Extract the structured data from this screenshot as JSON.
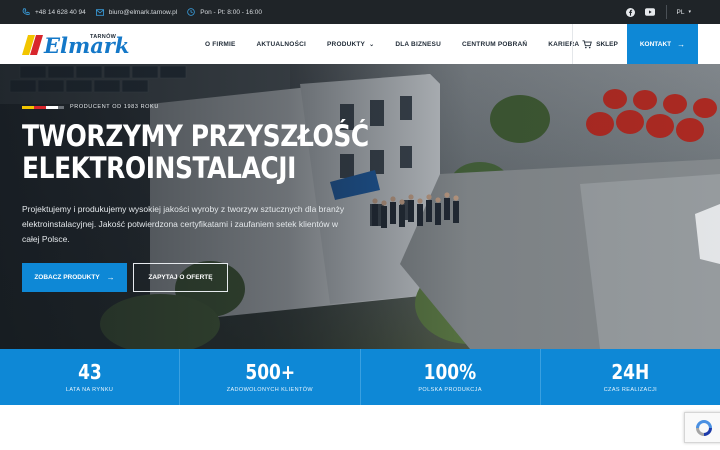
{
  "topbar": {
    "phone": "+48 14 628 40 94",
    "email": "biuro@elmark.tarnow.pl",
    "hours": "Pon - Pt: 8:00 - 16:00",
    "language": "PL"
  },
  "logo": {
    "brand": "Elmark",
    "city": "TARNÓW"
  },
  "nav": {
    "items": [
      {
        "label": "O FIRMIE"
      },
      {
        "label": "AKTUALNOŚCI"
      },
      {
        "label": "PRODUKTY"
      },
      {
        "label": "DLA BIZNESU"
      },
      {
        "label": "CENTRUM POBRAŃ"
      },
      {
        "label": "KARIERA"
      }
    ],
    "shop_label": "SKLEP",
    "contact_label": "KONTAKT"
  },
  "hero": {
    "tagline": "PRODUCENT OD 1983 ROKU",
    "headline_line1": "TWORZYMY PRZYSZŁOŚĆ",
    "headline_line2": "ELEKTROINSTALACJI",
    "description": "Projektujemy i produkujemy wysokiej jakości wyroby z tworzyw sztucznych dla branży elektroinstalacyjnej. Jakość potwierdzona certyfikatami i zaufaniem setek klientów w całej Polsce.",
    "primary_button": "ZOBACZ PRODUKTY",
    "secondary_button": "ZAPYTAJ O OFERTĘ"
  },
  "stats": [
    {
      "value": "43",
      "label": "LATA NA RYNKU"
    },
    {
      "value": "500+",
      "label": "ZADOWOLONYCH KLIENTÓW"
    },
    {
      "value": "100%",
      "label": "POLSKA PRODUKCJA"
    },
    {
      "value": "24H",
      "label": "CZAS REALIZACJI"
    }
  ],
  "colors": {
    "accent": "#0e88d6",
    "topbar_bg": "#1f2428",
    "flag_yellow": "#f2c500",
    "flag_red": "#d8262c"
  }
}
